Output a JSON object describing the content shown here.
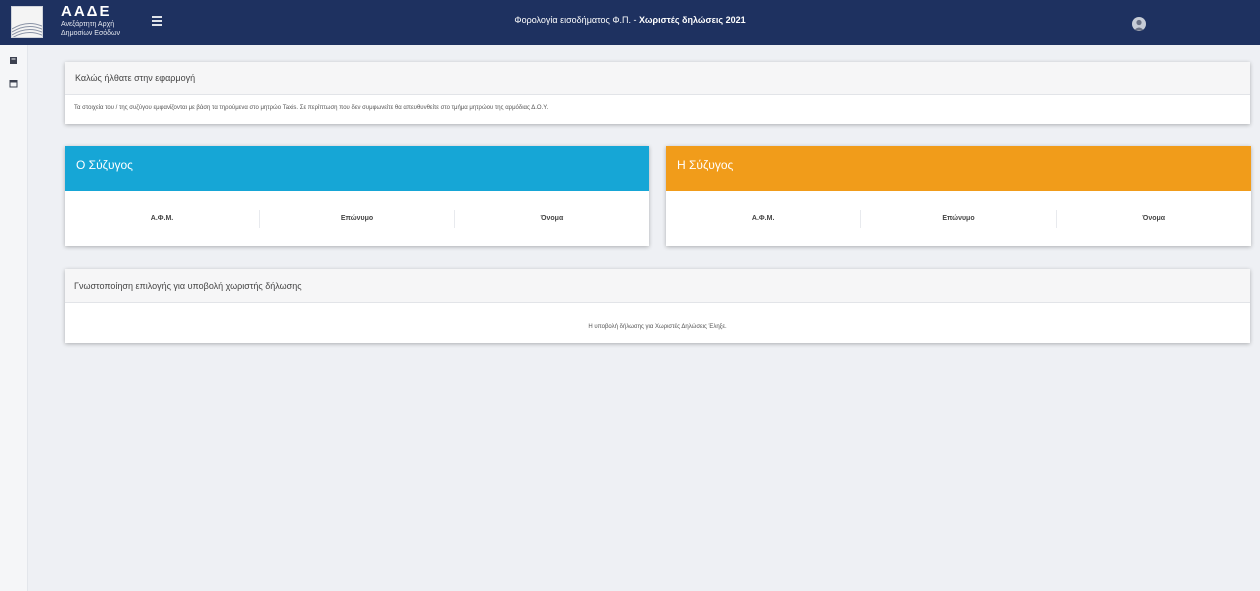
{
  "header": {
    "logo_title": "ΑΑΔΕ",
    "logo_sub1": "Ανεξάρτητη Αρχή",
    "logo_sub2": "Δημοσίων Εσόδων",
    "title_prefix": "Φορολογία εισοδήματος Φ.Π. - ",
    "title_bold": "Χωριστές δηλώσεις 2021",
    "brand_color": "#1e3160"
  },
  "sidebar": {
    "items": [
      {
        "icon": "book-icon"
      },
      {
        "icon": "calendar-icon"
      }
    ]
  },
  "welcome": {
    "title": "Καλώς ήλθατε στην εφαρμογή",
    "text": "Τα στοιχεία του / της συζύγου εμφανίζονται με βάση τα τηρούμενα στο μητρώο Taxis. Σε περίπτωση που δεν συμφωνείτε θα απευθυνθείτε στο τμήμα μητρώου της αρμόδιας Δ.Ο.Υ."
  },
  "husband": {
    "title": "Ο Σύζυγος",
    "color": "#16a6d6",
    "columns": [
      "Α.Φ.Μ.",
      "Επώνυμο",
      "Όνομα"
    ]
  },
  "wife": {
    "title": "Η Σύζυγος",
    "color": "#f19c1a",
    "columns": [
      "Α.Φ.Μ.",
      "Επώνυμο",
      "Όνομα"
    ]
  },
  "notice": {
    "title": "Γνωστοποίηση επιλογής για υποβολή χωριστής δήλωσης",
    "text": "Η υποβολή δήλωσης για Χωριστές Δηλώσεις Έληξε."
  }
}
